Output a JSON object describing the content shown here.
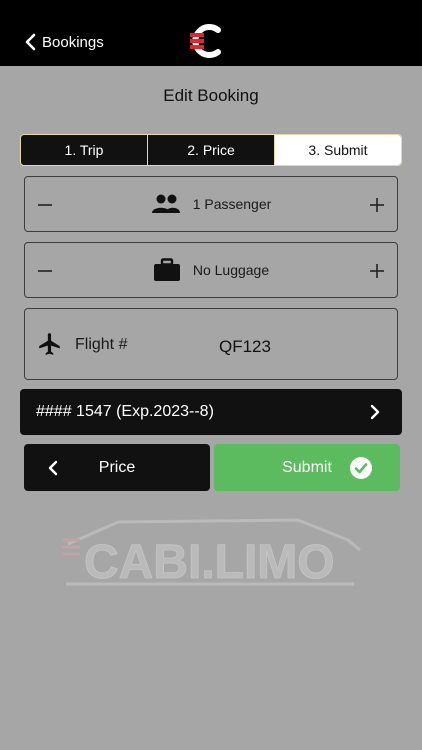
{
  "header": {
    "back_label": "Bookings"
  },
  "page": {
    "title": "Edit Booking"
  },
  "steps": [
    {
      "label": "1. Trip"
    },
    {
      "label": "2. Price"
    },
    {
      "label": "3. Submit"
    }
  ],
  "passengers": {
    "label": "1 Passenger",
    "icon": "people-icon"
  },
  "luggage": {
    "label": "No Luggage",
    "icon": "briefcase-icon"
  },
  "flight": {
    "label": "Flight #",
    "value": "QF123",
    "icon": "airplane-icon"
  },
  "payment": {
    "card_label": "#### 1547 (Exp.2023--8)"
  },
  "actions": {
    "price_label": "Price",
    "submit_label": "Submit"
  },
  "watermark": {
    "text": "CABI.LIMO"
  },
  "colors": {
    "header_bg": "#000000",
    "page_bg": "#a6a6a6",
    "submit_green": "#5cba5f",
    "brand_red": "#e3262b"
  }
}
